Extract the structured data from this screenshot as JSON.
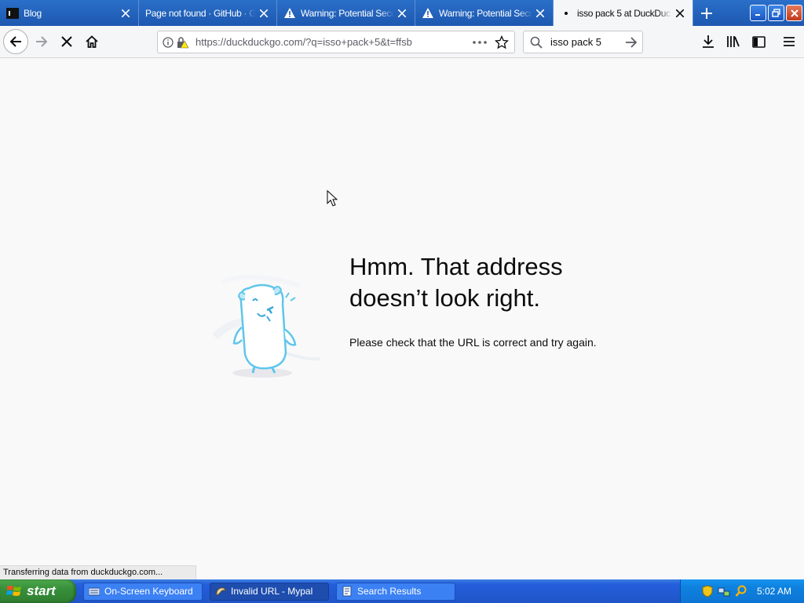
{
  "browser": {
    "tabs": [
      {
        "title": "Blog",
        "icon": "terminal-favicon",
        "active": false
      },
      {
        "title": "Page not found · GitHub · Gi",
        "icon": "none",
        "active": false
      },
      {
        "title": "Warning: Potential Secu",
        "icon": "warning-icon",
        "active": false
      },
      {
        "title": "Warning: Potential Secu",
        "icon": "warning-icon",
        "active": false
      },
      {
        "title": "isso pack 5 at DuckDuc",
        "icon": "loading-dot",
        "active": true
      }
    ],
    "url": "https://duckduckgo.com/?q=isso+pack+5&t=ffsb",
    "search_value": "isso pack 5"
  },
  "error_page": {
    "title": "Hmm. That address doesn’t look right.",
    "description": "Please check that the URL is correct and try again."
  },
  "status_text": "Transferring data from duckduckgo.com...",
  "taskbar": {
    "start_label": "start",
    "tasks": [
      {
        "label": "On-Screen Keyboard",
        "icon": "keyboard-icon",
        "active": false
      },
      {
        "label": "Invalid URL - Mypal",
        "icon": "mypal-icon",
        "active": true
      },
      {
        "label": "Search Results",
        "icon": "document-icon",
        "active": false
      }
    ],
    "clock": "5:02 AM"
  },
  "colors": {
    "tab_strip": "#1d58b0",
    "active_tab": "#f5f6f7",
    "taskbar": "#245edb",
    "start_button": "#37903a",
    "tray": "#0f82e0"
  }
}
